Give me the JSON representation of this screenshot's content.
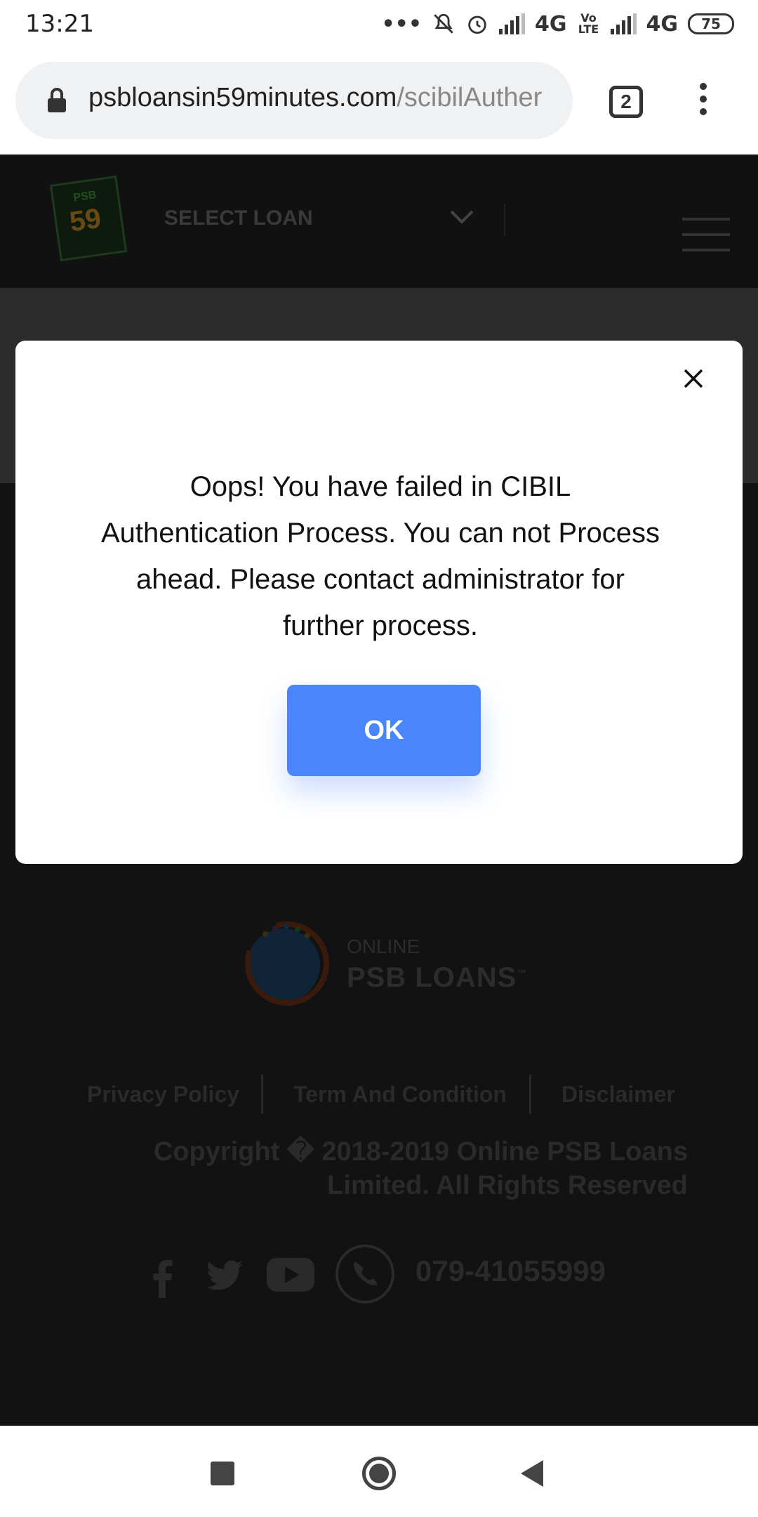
{
  "status_bar": {
    "time": "13:21",
    "network_1": "4G",
    "volte": "Vo LTE",
    "network_2": "4G",
    "battery": "75"
  },
  "browser": {
    "url_domain": "psbloansin59minutes.com",
    "url_path": "/scibilAuther",
    "tab_count": "2"
  },
  "header": {
    "logo_top": "PSB",
    "logo_number": "59",
    "select_loan": "SELECT LOAN"
  },
  "modal": {
    "message": "Oops! You have failed in CIBIL Authentication Process. You can not Process ahead. Please contact administrator for further process.",
    "ok_label": "OK"
  },
  "footer": {
    "brand_sub": "ONLINE",
    "brand": "PSB LOANS",
    "trademark": "™",
    "links": [
      "Privacy Policy",
      "Term And Condition",
      "Disclaimer"
    ],
    "copyright": "Copyright � 2018-2019 Online PSB Loans Limited. All Rights Reserved",
    "phone": "079-41055999",
    "social_icons": [
      "facebook-icon",
      "twitter-icon",
      "youtube-icon",
      "phone-icon"
    ]
  },
  "colors": {
    "accent": "#4a86fb",
    "page_background": "#121212"
  }
}
